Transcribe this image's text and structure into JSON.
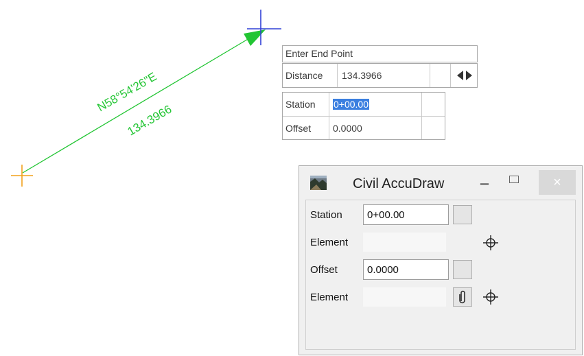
{
  "canvas": {
    "bearing_label": "N58°54'26\"E",
    "distance_label": "134.3966",
    "line_color": "#22c533",
    "start_cursor_color": "#f2a21c",
    "end_cursor_color": "#2f3fd6"
  },
  "prompt": {
    "title": "Enter End Point",
    "distance_label": "Distance",
    "distance_value": "134.3966",
    "station_label": "Station",
    "station_value": "0+00.00",
    "offset_label": "Offset",
    "offset_value": "0.0000"
  },
  "accudraw": {
    "title": "Civil AccuDraw",
    "minimize_glyph": "–",
    "maximize_glyph": "□",
    "close_glyph": "×",
    "close_color": "#d9d9d9",
    "rows": {
      "station_label": "Station",
      "station_value": "0+00.00",
      "element1_label": "Element",
      "element1_value": "",
      "offset_label": "Offset",
      "offset_value": "0.0000",
      "element2_label": "Element",
      "element2_value": ""
    }
  }
}
